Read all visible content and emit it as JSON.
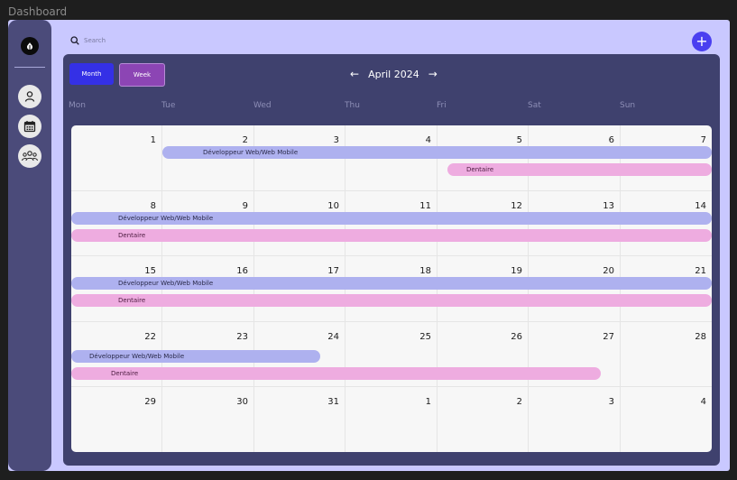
{
  "window": {
    "title": "Dashboard"
  },
  "sidebar": {
    "icons": [
      "logo-icon",
      "user-icon",
      "calendar-icon",
      "group-icon"
    ]
  },
  "search": {
    "placeholder": "Search"
  },
  "header": {
    "add_label": "+"
  },
  "calendar": {
    "view_buttons": {
      "month": "Month",
      "week": "Week"
    },
    "current_month": "April 2024",
    "prev_arrow": "←",
    "next_arrow": "→",
    "weekdays": [
      "Mon",
      "Tue",
      "Wed",
      "Thu",
      "Fri",
      "Sat",
      "Sun"
    ],
    "weeks": [
      [
        "1",
        "2",
        "3",
        "4",
        "5",
        "6",
        "7"
      ],
      [
        "8",
        "9",
        "10",
        "11",
        "12",
        "13",
        "14"
      ],
      [
        "15",
        "16",
        "17",
        "18",
        "19",
        "20",
        "21"
      ],
      [
        "22",
        "23",
        "24",
        "25",
        "26",
        "27",
        "28"
      ],
      [
        "29",
        "30",
        "31",
        "1",
        "2",
        "3",
        "4"
      ]
    ],
    "events": {
      "dev_label": "Développeur Web/Web Mobile",
      "den_label": "Dentaire"
    }
  },
  "colors": {
    "frame_bg": "#c9c8ff",
    "sidebar_bg": "#4b4b7a",
    "panel_bg": "#3f416e",
    "month_btn": "#3430e6",
    "week_btn": "#8c45b4",
    "add_btn": "#4a3ff0",
    "dev_event": "#aeb1ef",
    "den_event": "#eeace0"
  }
}
